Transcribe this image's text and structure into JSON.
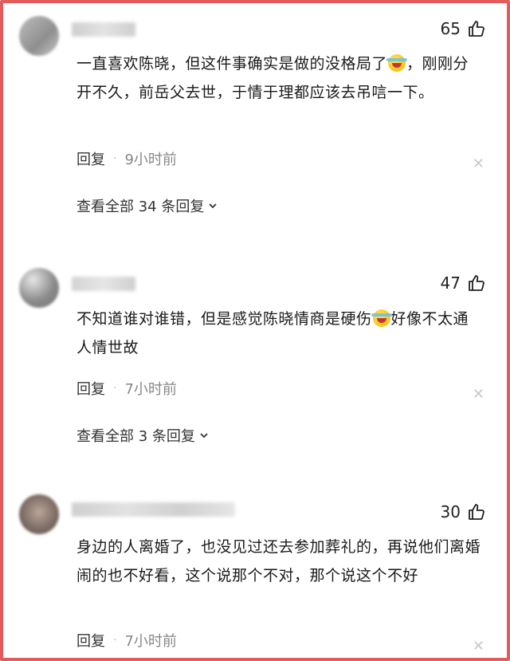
{
  "comments": [
    {
      "likes": "65",
      "text_a": "一直喜欢陈晓，但这件事确实是做的没格局了",
      "text_b": "，刚刚分开不久，前岳父去世，于情于理都应该去吊唁一下。",
      "reply_label": "回复",
      "dot": "·",
      "time": "9小时前",
      "view_replies": "查看全部 34 条回复"
    },
    {
      "likes": "47",
      "text_a": "不知道谁对谁错，但是感觉陈晓情商是硬伤",
      "text_b": "好像不太通人情世故",
      "reply_label": "回复",
      "dot": "·",
      "time": "7小时前",
      "view_replies": "查看全部 3 条回复"
    },
    {
      "likes": "30",
      "text_a": "身边的人离婚了，也没见过还去参加葬礼的，再说他们离婚闹的也不好看，这个说那个不对，那个说这个不好",
      "reply_label": "回复",
      "dot": "·",
      "time": "7小时前"
    }
  ],
  "icons": {
    "like": "thumbs-up-icon",
    "close": "close-icon",
    "expand": "chevron-down-icon",
    "emoji": "laughing-crying-emoji"
  },
  "colors": {
    "frame": "#e35b5b",
    "muted": "#888888"
  }
}
